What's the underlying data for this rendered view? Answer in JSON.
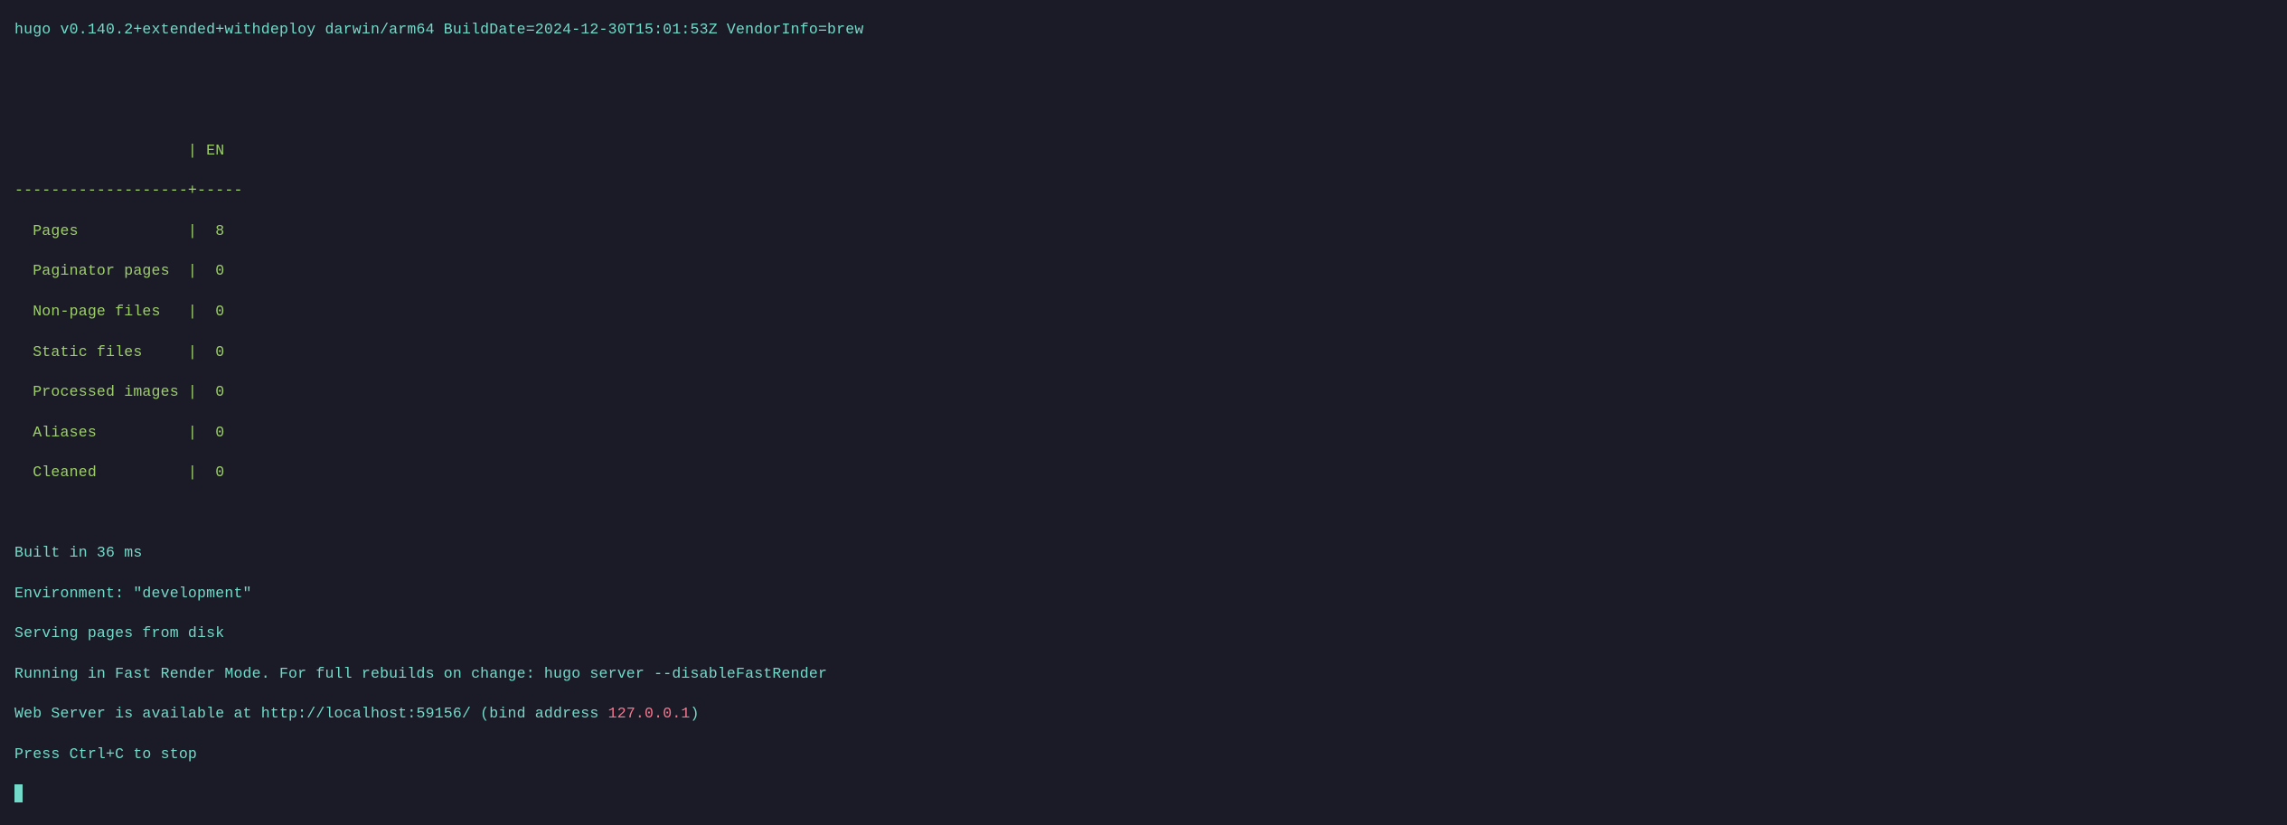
{
  "version_line": "hugo v0.140.2+extended+withdeploy darwin/arm64 BuildDate=2024-12-30T15:01:53Z VendorInfo=brew",
  "table_header": "                   | EN",
  "table_separator": "-------------------+-----",
  "rows": [
    "  Pages            |  8",
    "  Paginator pages  |  0",
    "  Non-page files   |  0",
    "  Static files     |  0",
    "  Processed images |  0",
    "  Aliases          |  0",
    "  Cleaned          |  0"
  ],
  "built_line": "Built in 36 ms",
  "env_line": "Environment: \"development\"",
  "serving_line": "Serving pages from disk",
  "fast_render_line": "Running in Fast Render Mode. For full rebuilds on change: hugo server --disableFastRender",
  "server_prefix": "Web Server is available at http://localhost:59156/ (bind address ",
  "server_ip": "127.0.0.1",
  "server_suffix": ")",
  "stop_line": "Press Ctrl+C to stop"
}
